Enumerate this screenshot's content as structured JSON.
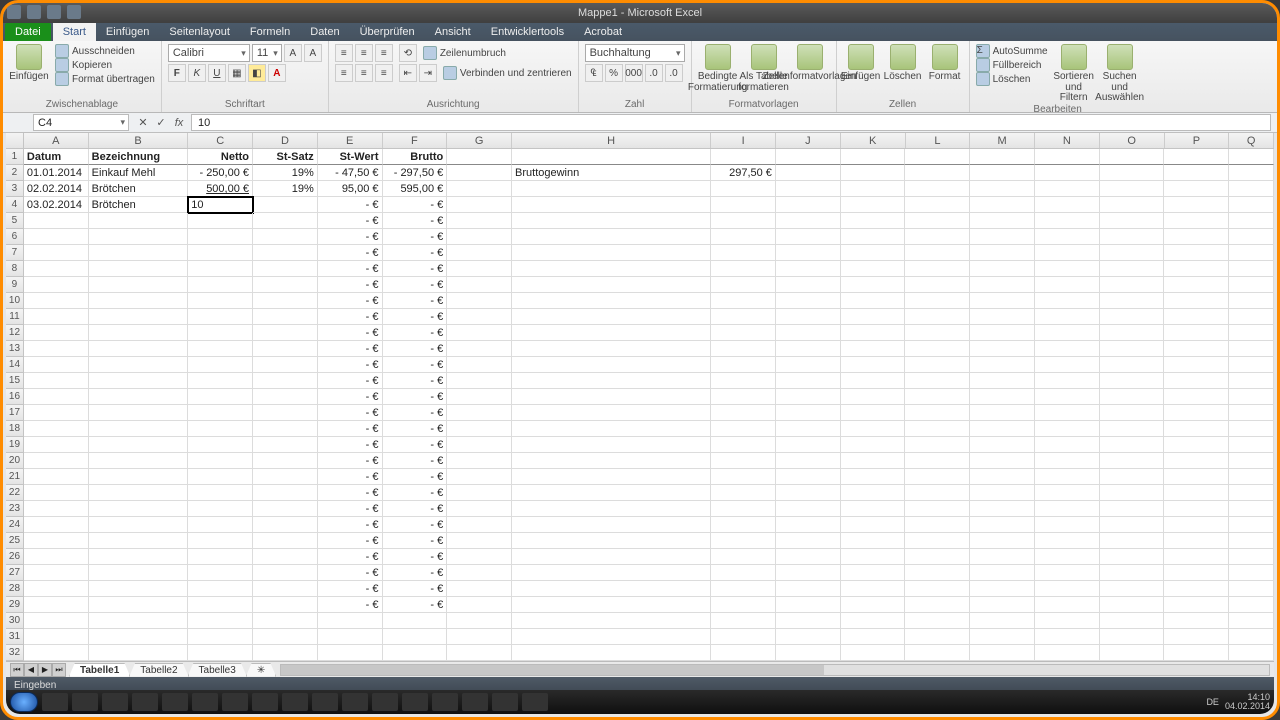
{
  "window": {
    "title": "Mappe1 - Microsoft Excel"
  },
  "ribbon": {
    "file": "Datei",
    "tabs": [
      "Start",
      "Einfügen",
      "Seitenlayout",
      "Formeln",
      "Daten",
      "Überprüfen",
      "Ansicht",
      "Entwicklertools",
      "Acrobat"
    ],
    "active": "Start",
    "clipboard": {
      "paste": "Einfügen",
      "cut": "Ausschneiden",
      "copy": "Kopieren",
      "format": "Format übertragen",
      "group": "Zwischenablage"
    },
    "font": {
      "name": "Calibri",
      "size": "11",
      "group": "Schriftart"
    },
    "alignment": {
      "wrap": "Zeilenumbruch",
      "merge": "Verbinden und zentrieren",
      "group": "Ausrichtung"
    },
    "number": {
      "format": "Buchhaltung",
      "group": "Zahl"
    },
    "styles": {
      "cond": "Bedingte Formatierung",
      "table": "Als Tabelle formatieren",
      "cell": "Zellenformatvorlagen",
      "group": "Formatvorlagen"
    },
    "cells": {
      "insert": "Einfügen",
      "delete": "Löschen",
      "format": "Format",
      "group": "Zellen"
    },
    "editing": {
      "sum": "AutoSumme",
      "fill": "Füllbereich",
      "clear": "Löschen",
      "sort": "Sortieren und Filtern",
      "find": "Suchen und Auswählen",
      "group": "Bearbeiten"
    }
  },
  "nameBox": "C4",
  "formulaBar": "10",
  "columns": [
    "A",
    "B",
    "C",
    "D",
    "E",
    "F",
    "G",
    "H",
    "I",
    "J",
    "K",
    "L",
    "M",
    "N",
    "O",
    "P",
    "Q"
  ],
  "headers": {
    "A": "Datum",
    "B": "Bezeichnung",
    "C": "Netto",
    "D": "St-Satz",
    "E": "St-Wert",
    "F": "Brutto",
    "H": "Bruttogewinn"
  },
  "rowsData": [
    {
      "A": "01.01.2014",
      "B": "Einkauf Mehl",
      "C": "-    250,00 €",
      "D": "19%",
      "E": "-     47,50 €",
      "F": "-    297,50 €",
      "H": "Bruttogewinn",
      "I": "297,50 €"
    },
    {
      "A": "02.02.2014",
      "B": "Brötchen",
      "C": "500,00 €",
      "D": "19%",
      "E": "95,00 €",
      "F": "595,00 €"
    },
    {
      "A": "03.02.2014",
      "B": "Brötchen",
      "C": "10"
    }
  ],
  "placeholder": {
    "E": "-   €",
    "F": "-   €"
  },
  "activeCell": "C4",
  "sheets": [
    "Tabelle1",
    "Tabelle2",
    "Tabelle3"
  ],
  "statusbar": "Eingeben",
  "tray": {
    "lang": "DE",
    "time": "14:10",
    "date": "04.02.2014"
  }
}
